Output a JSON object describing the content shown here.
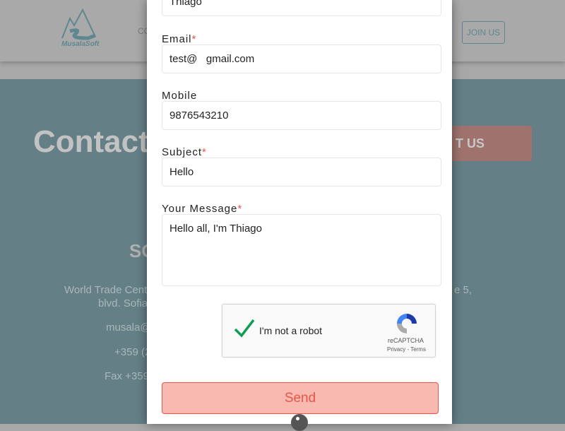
{
  "header": {
    "logo_text": "MusalaSoft",
    "nav_partial": "CO",
    "join_label": "JOIN US"
  },
  "background": {
    "title_partial": "Contact",
    "cta_partial": "T US",
    "section_partial": "SO",
    "address_line1": "World Trade Cent",
    "address_line2": "blvd. Sofia",
    "address_right": "e 5,",
    "email_partial": "musala@",
    "phone_partial": "+359 (2",
    "fax_partial": "Fax +359"
  },
  "form": {
    "name_value": "Thiago",
    "email_label": "Email",
    "email_value": "test@   gmail.com",
    "mobile_label": "Mobile",
    "mobile_value": "9876543210",
    "subject_label": "Subject",
    "subject_value": "Hello",
    "message_label": "Your Message",
    "message_value": "Hello all, I'm Thiago",
    "required_mark": "*",
    "captcha": {
      "label": "I'm not a robot",
      "brand": "reCAPTCHA",
      "links": "Privacy - Terms",
      "checked": true
    },
    "send_label": "Send"
  },
  "colors": {
    "accent": "#e8564a",
    "teal": "#5f8790",
    "check": "#0f9d58"
  }
}
